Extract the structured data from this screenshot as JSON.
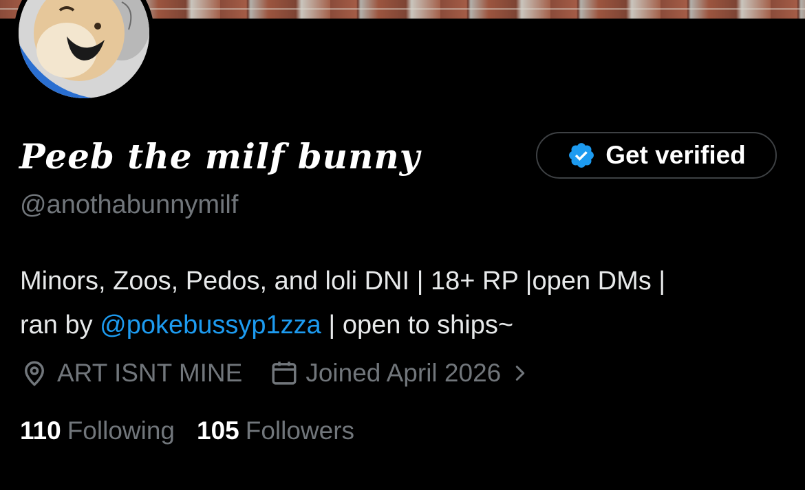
{
  "profile": {
    "display_name": "Peeb the milf bunny",
    "handle": "@anothabunnymilf",
    "avatar_icon": "bunny-cartoon-avatar",
    "verify_button": {
      "label": "Get verified",
      "icon": "verified-badge-icon"
    },
    "bio": {
      "part1": "Minors, Zoos, Pedos, and loli DNI | 18+ RP |open DMs |",
      "part2_prefix": "ran by ",
      "mention": "@pokebussyp1zza",
      "part2_suffix": " | open to ships~"
    },
    "location": {
      "icon": "location-pin-icon",
      "text": "ART ISNT MINE"
    },
    "joined": {
      "icon": "calendar-icon",
      "text": "Joined April 2026",
      "chevron_icon": "chevron-right-icon"
    },
    "following": {
      "count": "110",
      "label": "Following"
    },
    "followers": {
      "count": "105",
      "label": "Followers"
    }
  },
  "colors": {
    "background": "#000000",
    "text_primary": "#e7e9ea",
    "text_secondary": "#71767b",
    "link": "#1d9bf0",
    "verified_blue": "#1d9bf0",
    "button_border": "#3e4144"
  }
}
